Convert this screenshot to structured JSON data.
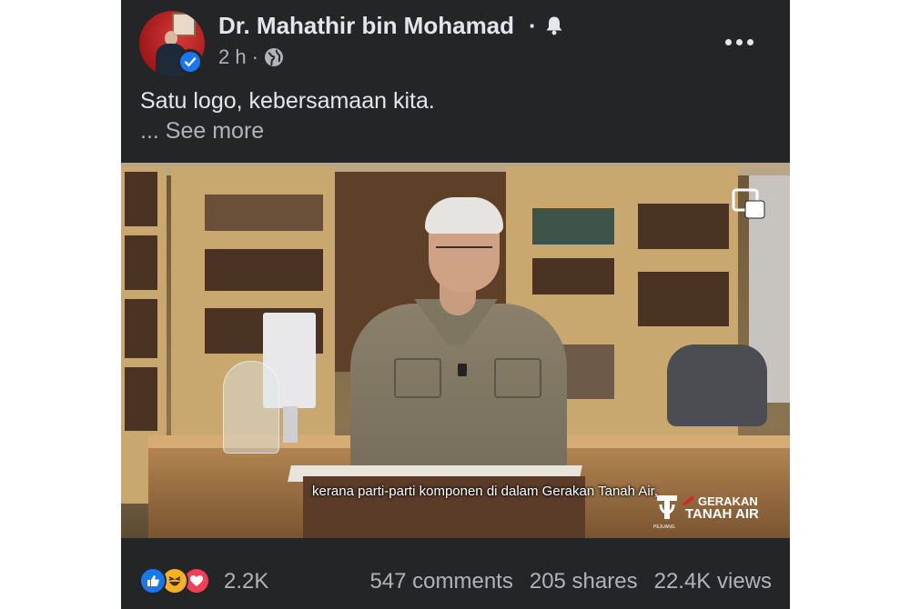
{
  "post": {
    "author": "Dr. Mahathir bin Mohamad",
    "separator": "·",
    "time": "2 h",
    "meta_dot": "·",
    "privacy_icon": "globe-icon",
    "caption": "Satu logo, kebersamaan kita.",
    "see_more": "... See more"
  },
  "video": {
    "subtitle": "kerana parti-parti komponen di dalam Gerakan Tanah Air,",
    "logo_line1": "GERAKAN",
    "logo_line2": "TANAH AIR",
    "logo_small": "PEJUANG",
    "pip_icon": "picture-in-picture-icon"
  },
  "footer": {
    "reaction_icons": [
      "like-icon",
      "haha-icon",
      "love-icon"
    ],
    "reaction_count": "2.2K",
    "comments": "547 comments",
    "shares": "205 shares",
    "views": "22.4K views"
  },
  "colors": {
    "background": "#242526",
    "text_primary": "#e4e6eb",
    "text_secondary": "#b0b3b8",
    "like_blue": "#1877f2",
    "haha_yellow": "#f7b125",
    "love_red": "#f33e58",
    "logo_red": "#d8262e"
  }
}
